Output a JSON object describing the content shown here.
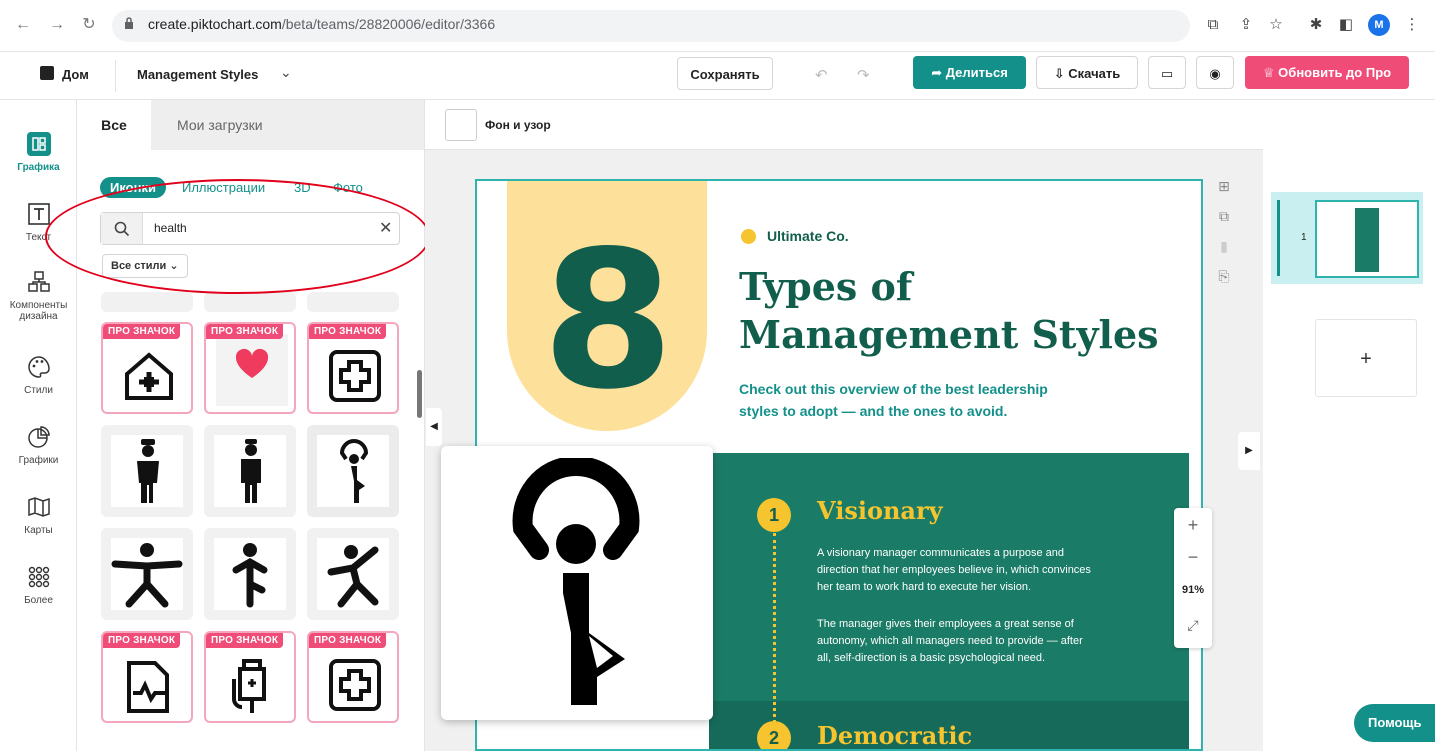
{
  "browser": {
    "url_host": "create.piktochart.com",
    "url_path": "/beta/teams/28820006/editor/3366",
    "avatar_letter": "M"
  },
  "header": {
    "home_label": "Дом",
    "doc_title": "Management Styles",
    "save_label": "Сохранять",
    "share_label": "Делиться",
    "download_label": "Скачать",
    "upgrade_label": "Обновить до Про"
  },
  "rail": {
    "items": [
      {
        "label": "Графика",
        "icon": "graphics-icon"
      },
      {
        "label": "Текст",
        "icon": "text-icon"
      },
      {
        "label": "Компоненты дизайна",
        "icon": "components-icon"
      },
      {
        "label": "Стили",
        "icon": "palette-icon"
      },
      {
        "label": "Графики",
        "icon": "chart-icon"
      },
      {
        "label": "Карты",
        "icon": "map-icon"
      },
      {
        "label": "Более",
        "icon": "more-grid-icon"
      }
    ]
  },
  "panel": {
    "tab_all": "Все",
    "tab_uploads": "Мои загрузки",
    "chips": [
      "Иконки",
      "Иллюстрации",
      "3D",
      "Фото"
    ],
    "search_value": "health",
    "styles_label": "Все стили",
    "pro_badge": "ПРО ЗНАЧОК"
  },
  "canvas": {
    "bg_label": "Фон и узор",
    "company": "Ultimate Co.",
    "big_number": "8",
    "title_line1": "Types of",
    "title_line2": "Management Styles",
    "subtitle_line1": "Check out this overview of the best leadership",
    "subtitle_line2": "styles to adopt — and the ones to avoid.",
    "section1_num": "1",
    "section1_title": "Visionary",
    "section1_p1_l1": "A visionary manager communicates a purpose and",
    "section1_p1_l2": "direction that her employees believe in, which convinces",
    "section1_p1_l3": "her team to work hard to execute her vision.",
    "section1_p2_l1": "The manager gives their employees a great sense of",
    "section1_p2_l2": "autonomy, which all managers need to provide — after",
    "section1_p2_l3": "all, self-direction is a basic psychological need.",
    "section2_num": "2",
    "section2_title": "Democratic",
    "zoom_level": "91%"
  },
  "pages": {
    "page_number": "1"
  },
  "help_label": "Помощь",
  "colors": {
    "teal": "#13908a",
    "pink": "#ef4c78",
    "dark_green": "#115e4c",
    "yellow": "#f6c42f"
  }
}
